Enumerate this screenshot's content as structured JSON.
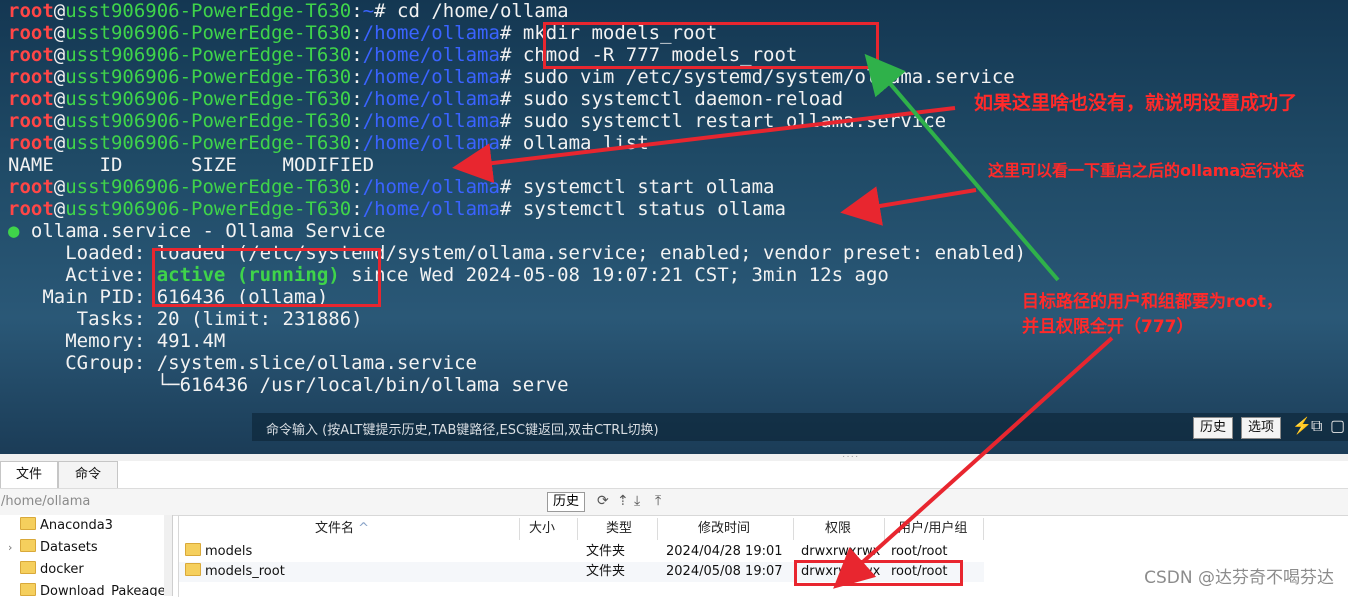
{
  "prompt": {
    "user": "root",
    "at": "@",
    "host": "usst906906-PowerEdge-T630",
    "colon": ":",
    "hash": "#"
  },
  "terminal": {
    "commands": [
      {
        "path": "~",
        "cmd": " cd /home/ollama"
      },
      {
        "path": "/home/ollama",
        "cmd": " mkdir models_root"
      },
      {
        "path": "/home/ollama",
        "cmd": " chmod -R 777 models_root"
      },
      {
        "path": "/home/ollama",
        "cmd": " sudo vim /etc/systemd/system/ollama.service"
      },
      {
        "path": "/home/ollama",
        "cmd": " sudo systemctl daemon-reload"
      },
      {
        "path": "/home/ollama",
        "cmd": " sudo systemctl restart ollama.service"
      },
      {
        "path": "/home/ollama",
        "cmd": " ollama list"
      }
    ],
    "list_header": "NAME    ID      SIZE    MODIFIED",
    "commands2": [
      {
        "path": "/home/ollama",
        "cmd": " systemctl start ollama"
      },
      {
        "path": "/home/ollama",
        "cmd": " systemctl status ollama"
      }
    ],
    "status": {
      "dot": "●",
      "service_line": " ollama.service - Ollama Service",
      "loaded_label": "     Loaded:",
      "loaded_value": " loaded (/etc/systemd/system/ollama.service; enabled; vendor preset: enabled)",
      "active_label": "     Active:",
      "active_state": " active (running)",
      "active_rest": " since Wed 2024-05-08 19:07:21 CST; 3min 12s ago",
      "pid_line": "   Main PID: 616436 (ollama)",
      "tasks_line": "      Tasks: 20 (limit: 231886)",
      "memory_line": "     Memory: 491.4M",
      "cgroup_line": "     CGroup: /system.slice/ollama.service",
      "tree_line": "             └─616436 /usr/local/bin/ollama serve"
    }
  },
  "command_bar": {
    "hint": "命令输入 (按ALT键提示历史,TAB键路径,ESC键返回,双击CTRL切换)",
    "history_button": "历史",
    "options_button": "选项",
    "icons": [
      "lightning-icon",
      "copy-icon",
      "window-icon"
    ]
  },
  "file_manager": {
    "tabs": [
      "文件",
      "命令"
    ],
    "path": "/home/ollama",
    "history_button": "历史",
    "tools": [
      "refresh-icon",
      "up-icon",
      "download-icon",
      "upload-icon"
    ],
    "tree": [
      {
        "label": "Anaconda3",
        "expandable": false
      },
      {
        "label": "Datasets",
        "expandable": true
      },
      {
        "label": "docker",
        "expandable": false
      },
      {
        "label": "Download_Pakeage",
        "expandable": false
      }
    ],
    "columns": {
      "name": "文件名",
      "size": "大小",
      "type": "类型",
      "modified": "修改时间",
      "perm": "权限",
      "owner": "用户/用户组"
    },
    "sort_indicator": "^",
    "rows": [
      {
        "name": "models",
        "size": "",
        "type": "文件夹",
        "modified": "2024/04/28 19:01",
        "perm": "drwxrwxrwx",
        "owner": "root/root"
      },
      {
        "name": "models_root",
        "size": "",
        "type": "文件夹",
        "modified": "2024/05/08 19:07",
        "perm": "drwxrwxrwx",
        "owner": "root/root"
      }
    ]
  },
  "annotations": {
    "note_success": "如果这里啥也没有，就说明设置成功了",
    "note_status": "这里可以看一下重启之后的ollama运行状态",
    "note_owner_1": "目标路径的用户和组都要为root，",
    "note_owner_2": "并且权限全开（777）",
    "red_color": "#e8262f",
    "green_color": "#2fb14a"
  },
  "watermark": "CSDN @达芬奇不喝芬达"
}
